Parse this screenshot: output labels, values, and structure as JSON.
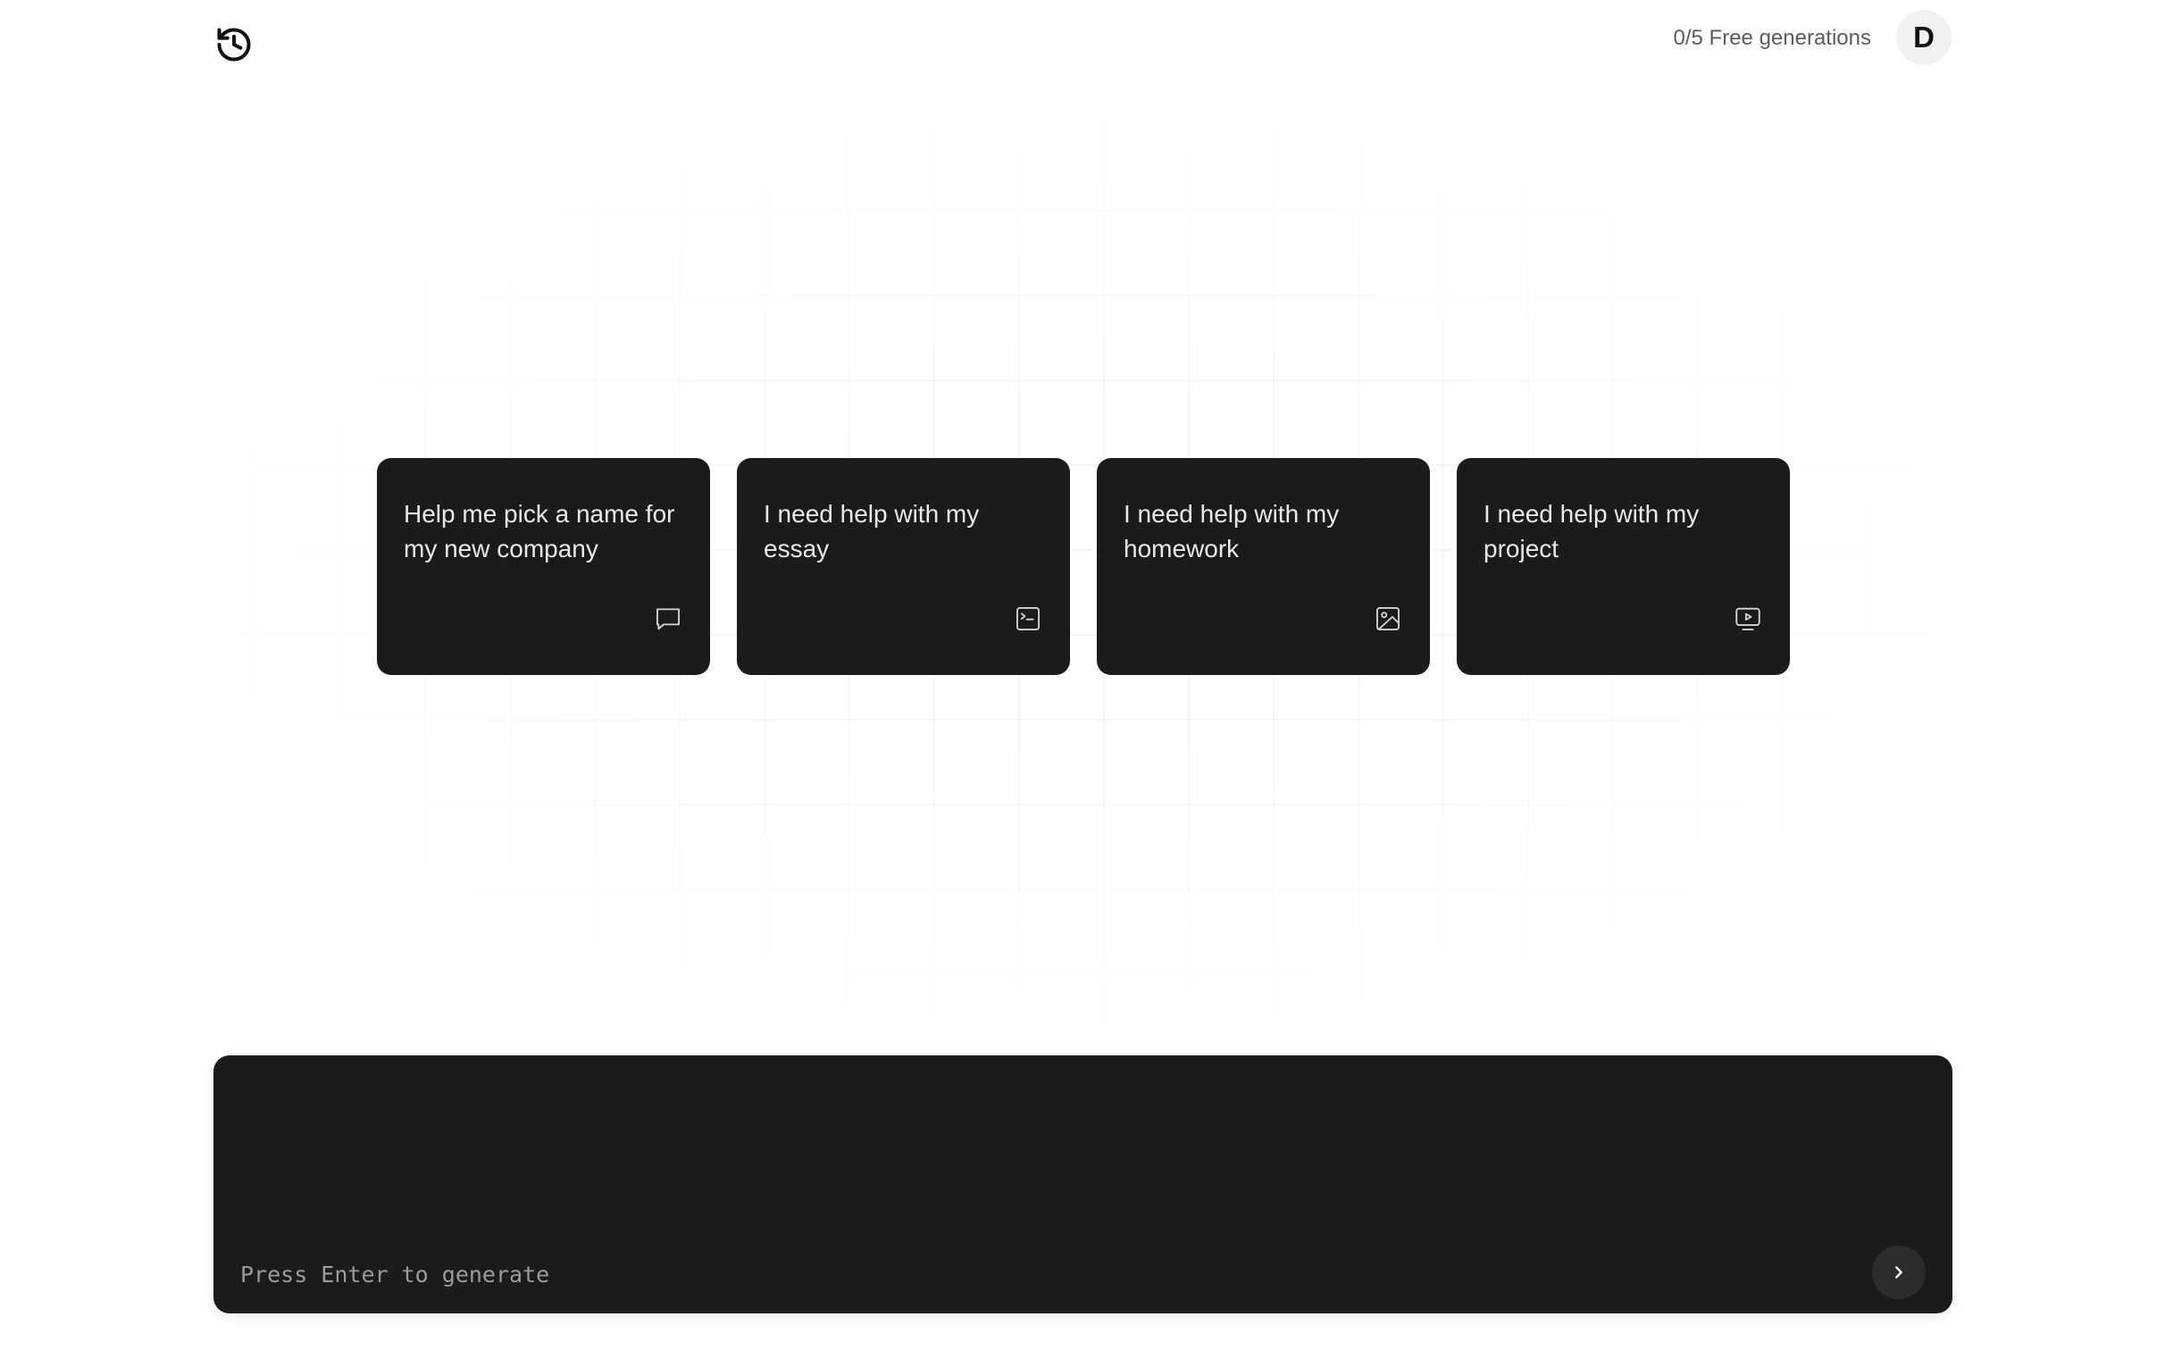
{
  "header": {
    "history_icon": "history-icon",
    "generations_label": "0/5 Free generations",
    "avatar_initial": "D"
  },
  "suggestions": [
    {
      "text": "Help me pick a name for my new company",
      "icon": "chat-bubble-icon"
    },
    {
      "text": "I need help with my essay",
      "icon": "terminal-icon"
    },
    {
      "text": "I need help with my homework",
      "icon": "image-icon"
    },
    {
      "text": "I need help with my project",
      "icon": "video-play-icon"
    }
  ],
  "prompt": {
    "value": "",
    "placeholder": "Press Enter to generate",
    "submit_icon": "chevron-right-icon"
  },
  "colors": {
    "card_background": "#1b1b1d",
    "card_text": "#e9e9e9",
    "page_background": "#ffffff",
    "muted_text": "#5c5c5c"
  }
}
